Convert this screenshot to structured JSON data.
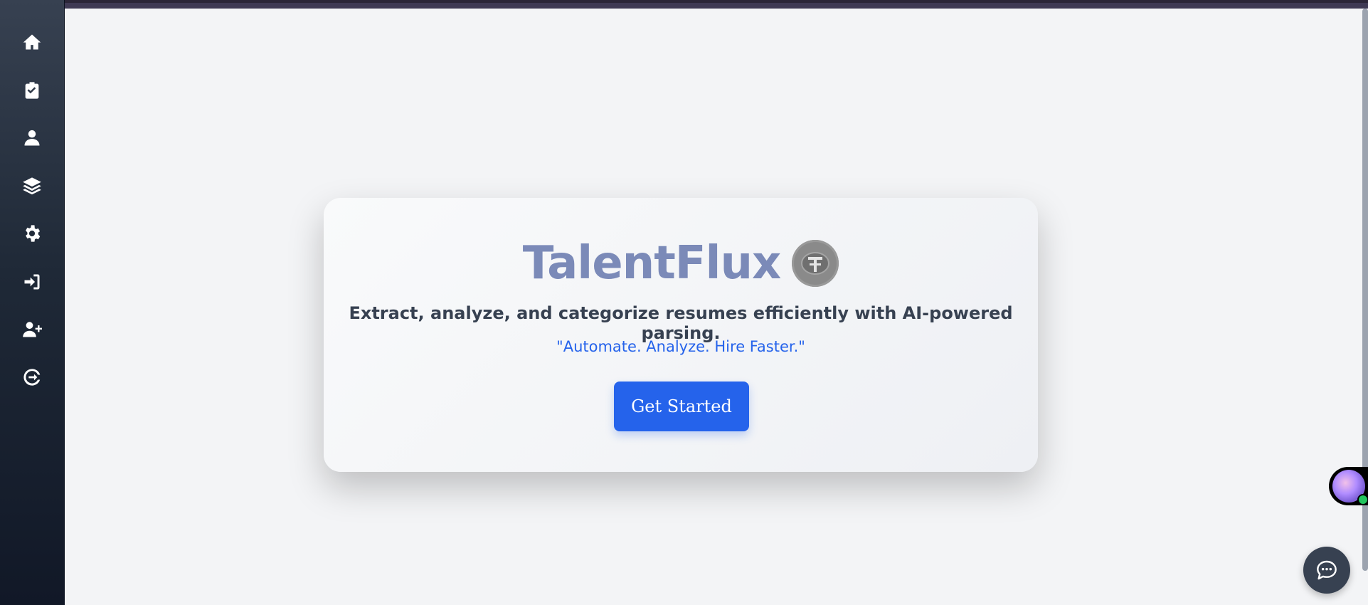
{
  "sidebar": {
    "items": [
      {
        "name": "home",
        "icon": "home-icon"
      },
      {
        "name": "tasks",
        "icon": "clipboard-check-icon"
      },
      {
        "name": "profile",
        "icon": "user-icon"
      },
      {
        "name": "layers",
        "icon": "layers-icon"
      },
      {
        "name": "settings",
        "icon": "gear-icon"
      },
      {
        "name": "login",
        "icon": "sign-in-icon"
      },
      {
        "name": "register",
        "icon": "user-plus-icon"
      },
      {
        "name": "logout",
        "icon": "logout-icon"
      }
    ]
  },
  "hero": {
    "title": "TalentFlux",
    "subtitle": "Extract, analyze, and categorize resumes efficiently with AI-powered parsing.",
    "tagline": "\"Automate. Analyze. Hire Faster.\"",
    "cta_label": "Get Started"
  },
  "colors": {
    "sidebar_top": "#374151",
    "sidebar_bottom": "#111827",
    "title": "#7b8ab8",
    "accent": "#2563eb",
    "background": "#f3f4f6"
  }
}
